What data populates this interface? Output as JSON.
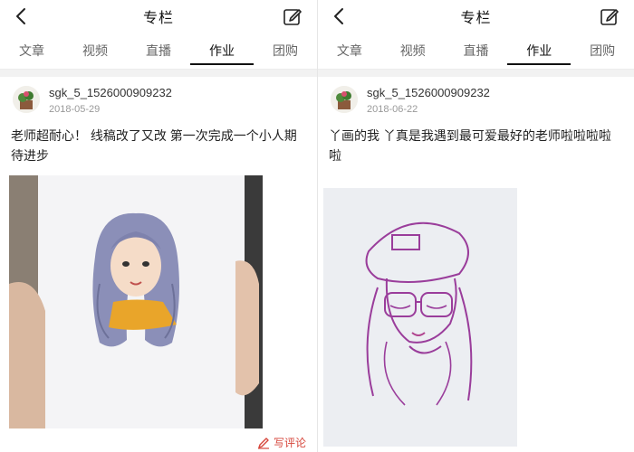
{
  "screens": [
    {
      "title": "专栏",
      "tabs": [
        "文章",
        "视频",
        "直播",
        "作业",
        "团购"
      ],
      "active_tab": "作业",
      "post": {
        "username": "sgk_5_1526000909232",
        "date": "2018-05-29",
        "text": "老师超耐心！ 线稿改了又改  第一次完成一个小人期待进步",
        "image_icon": "watercolor-portrait-photo"
      },
      "comment_label": "写评论"
    },
    {
      "title": "专栏",
      "tabs": [
        "文章",
        "视频",
        "直播",
        "作业",
        "团购"
      ],
      "active_tab": "作业",
      "post": {
        "username": "sgk_5_1526000909232",
        "date": "2018-06-22",
        "text": "丫画的我 丫真是我遇到最可爱最好的老师啦啦啦啦啦",
        "image_icon": "pencil-sketch-photo"
      }
    }
  ],
  "colors": {
    "accent_comment": "#d6463b",
    "tab_active_underline": "#111111"
  }
}
